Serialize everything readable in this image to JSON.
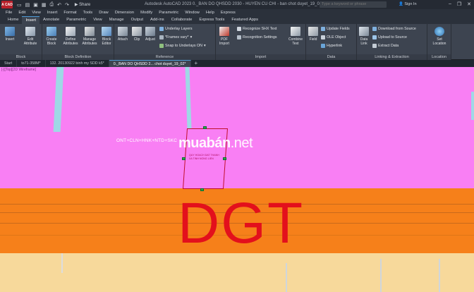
{
  "app": {
    "logo_text": "A CAD",
    "share_label": "Share",
    "title": "Autodesk AutoCAD 2023    0._BAN DO QHSDD 2030 - HUYEN CU CHI - ban chot duyet_19_02.dwg",
    "search_placeholder": "Type a keyword or phrase",
    "signin_label": "Sign In"
  },
  "menu": [
    "File",
    "Edit",
    "View",
    "Insert",
    "Format",
    "Tools",
    "Draw",
    "Dimension",
    "Modify",
    "Parametric",
    "Window",
    "Help",
    "Express"
  ],
  "ribbon_tabs": [
    {
      "label": "Home",
      "active": false
    },
    {
      "label": "Insert",
      "active": true
    },
    {
      "label": "Annotate",
      "active": false
    },
    {
      "label": "Parametric",
      "active": false
    },
    {
      "label": "View",
      "active": false
    },
    {
      "label": "Manage",
      "active": false
    },
    {
      "label": "Output",
      "active": false
    },
    {
      "label": "Add-ins",
      "active": false
    },
    {
      "label": "Collaborate",
      "active": false
    },
    {
      "label": "Express Tools",
      "active": false
    },
    {
      "label": "Featured Apps",
      "active": false
    }
  ],
  "ribbon": {
    "block_panel": {
      "title": "Block",
      "insert": "Insert",
      "edit_attribute": "Edit Attribute"
    },
    "block_def_panel": {
      "title": "Block Definition",
      "create": "Create Block",
      "define": "Define Attributes",
      "manage": "Manage Attributes",
      "editor": "Block Editor"
    },
    "reference_panel": {
      "title": "Reference",
      "attach": "Attach",
      "clip": "Clip",
      "adjust": "Adjust",
      "underlay_layers": "Underlay Layers",
      "frames": "*Frames vary*",
      "snap": "Snap to Underlays ON"
    },
    "import_panel": {
      "title": "Import",
      "pdf": "PDF Import",
      "recognize": "Recognize SHX Text",
      "recognition": "Recognition Settings",
      "combine": "Combine Text"
    },
    "data_panel": {
      "title": "Data",
      "field": "Field",
      "update_fields": "Update Fields",
      "ole": "OLE Object",
      "hyperlink": "Hyperlink"
    },
    "linking_panel": {
      "title": "Linking & Extraction",
      "data_link": "Data Link",
      "download": "Download from Source",
      "upload": "Upload to Source",
      "extract": "Extract  Data"
    },
    "location_panel": {
      "title": "Location",
      "set_location": "Set Location"
    }
  },
  "doc_tabs": [
    {
      "label": "Start",
      "active": false
    },
    {
      "label": "to71-358M*",
      "active": false
    },
    {
      "label": "132. 20130922 binh my SDD k5*",
      "active": false
    },
    {
      "label": "0._BAN DO QHSDD 2... chot duyet_19_02*",
      "active": true
    }
  ],
  "canvas": {
    "viewport_label": "[-][Top][2D Wireframe]",
    "land_code": "ONT+CLN+HNK+NTD+SKC",
    "plot_label_line1": "QUY HOACH DAT THANH",
    "plot_label_line2": "XA TINH NONG LIEN",
    "watermark_bold": "muabán",
    "watermark_light": ".net",
    "zone_label": "DGT"
  },
  "colors": {
    "residential_zone": "#f97ff4",
    "road_zone": "#f6801a",
    "agri_zone": "#f7d99b",
    "canal": "#9fd8e6",
    "zone_text": "#e3101c",
    "accent": "#4e9bd6"
  }
}
